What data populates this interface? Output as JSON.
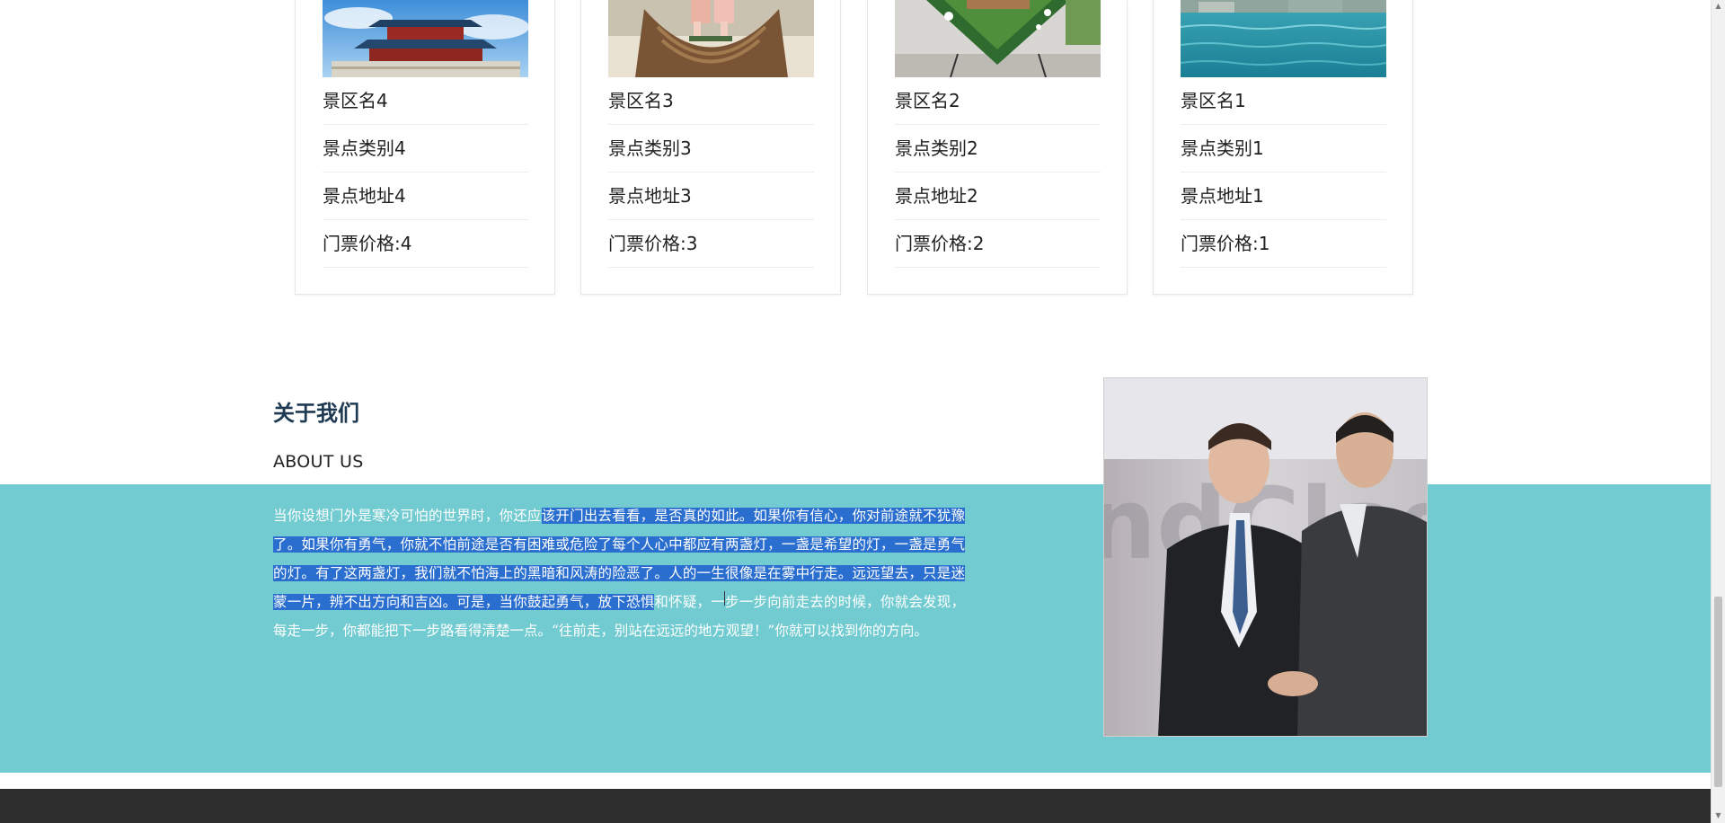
{
  "cards": [
    {
      "name": "景区名4",
      "category": "景点类别4",
      "address": "景点地址4",
      "price": "门票价格:4",
      "image_icon": "temple-photo-icon"
    },
    {
      "name": "景区名3",
      "category": "景点类别3",
      "address": "景点地址3",
      "price": "门票价格:3",
      "image_icon": "chair-photo-icon"
    },
    {
      "name": "景区名2",
      "category": "景点类别2",
      "address": "景点地址2",
      "price": "门票价格:2",
      "image_icon": "garden-photo-icon"
    },
    {
      "name": "景区名1",
      "category": "景点类别1",
      "address": "景点地址1",
      "price": "门票价格:1",
      "image_icon": "harbor-photo-icon"
    }
  ],
  "about": {
    "title": "关于我们",
    "subtitle": "ABOUT US",
    "text_parts": [
      "当你设想门外是寒冷可怕的世界时，你还应",
      "该开门出去看看，是否真的如此。如果你有信心，你对前途就不犹豫了。如果你有勇气，你就不怕前途是否有困难或危险了每个人心中都应有两盏灯，一盏是希望的灯，一盏是勇气的灯。有了这两盏灯，我们就不怕海上的黑暗和风涛的险恶了。人的一生很像是在雾中行走。远远望去，只是迷蒙一片，辨不出方向和吉凶。可是，当你鼓起勇气，放下恐惧",
      "和怀疑，一步一步向前走去的时候，你就会发现，每走一步，你都能把下一步路看得清楚一点。“往前走，别站在远远的地方观望！”你就可以找到你的方向。"
    ],
    "photo_icon": "business-handshake-photo-icon"
  },
  "colors": {
    "teal_band": "#71cbd1",
    "title": "#1e3a52",
    "selection": "#2a6fcf",
    "footer": "#2d2d2d"
  }
}
